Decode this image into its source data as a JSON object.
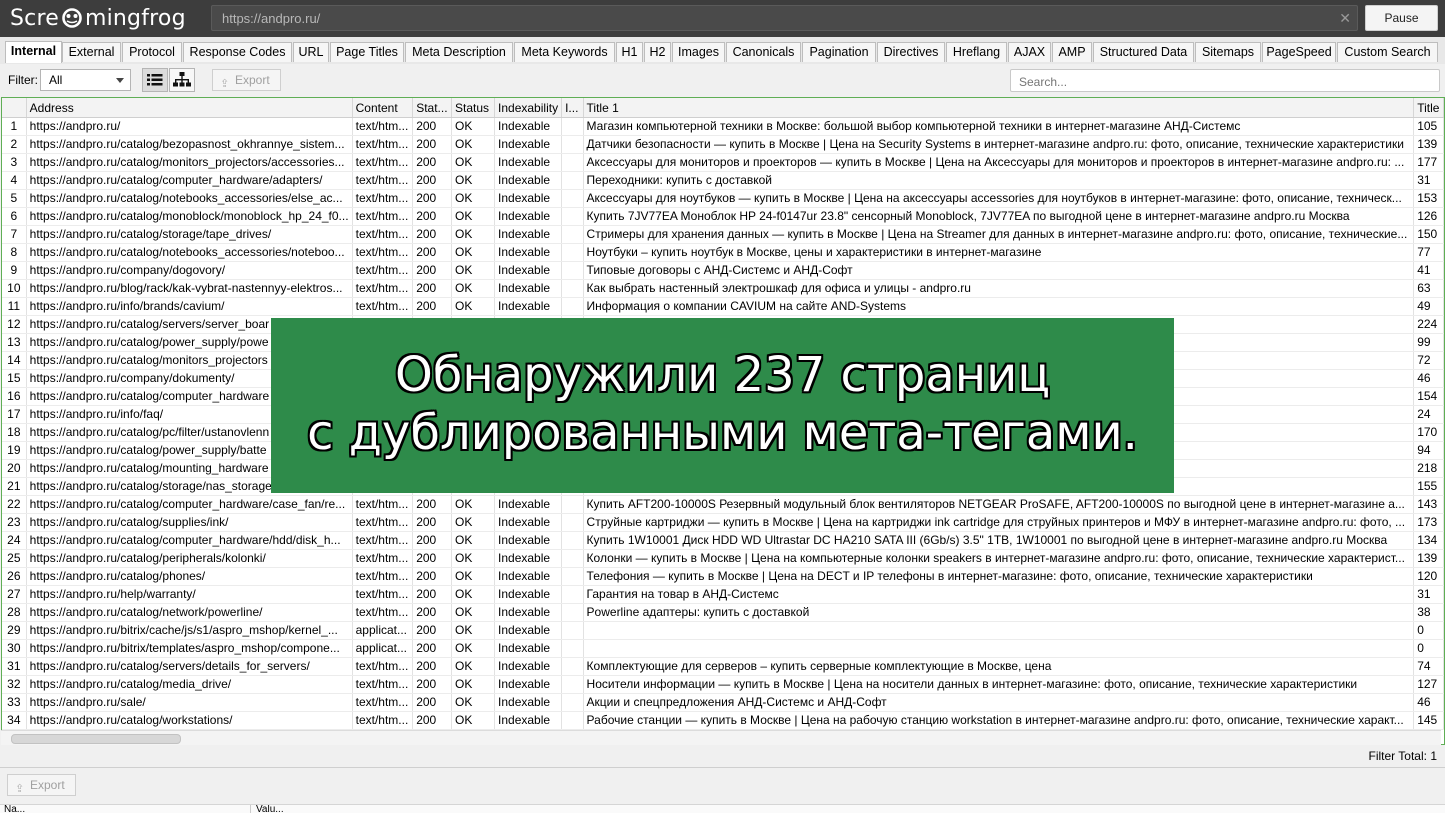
{
  "app": {
    "logo_pre": "Scre",
    "logo_post": "mingfrog"
  },
  "url_bar": {
    "value": "https://andpro.ru/",
    "clear": "✕"
  },
  "pause_label": "Pause",
  "tabs": [
    "Internal",
    "External",
    "Protocol",
    "Response Codes",
    "URL",
    "Page Titles",
    "Meta Description",
    "Meta Keywords",
    "H1",
    "H2",
    "Images",
    "Canonicals",
    "Pagination",
    "Directives",
    "Hreflang",
    "AJAX",
    "AMP",
    "Structured Data",
    "Sitemaps",
    "PageSpeed",
    "Custom Search"
  ],
  "filter": {
    "label": "Filter:",
    "value": "All"
  },
  "export_label": "Export",
  "search_placeholder": "Search...",
  "columns": [
    "",
    "Address",
    "Content",
    "Stat...",
    "Status",
    "Indexability",
    "I...",
    "Title 1",
    "Title"
  ],
  "rows": [
    [
      "1",
      "https://andpro.ru/",
      "text/htm...",
      "200",
      "OK",
      "Indexable",
      "",
      "Магазин компьютерной техники в Москве: большой выбор компьютерной техники в интернет-магазине АНД-Системс",
      "105"
    ],
    [
      "2",
      "https://andpro.ru/catalog/bezopasnost_okhrannye_sistem...",
      "text/htm...",
      "200",
      "OK",
      "Indexable",
      "",
      "Датчики безопасности — купить в Москве | Цена на Security Systems в интернет-магазине andpro.ru: фото, описание, технические характеристики",
      "139"
    ],
    [
      "3",
      "https://andpro.ru/catalog/monitors_projectors/accessories...",
      "text/htm...",
      "200",
      "OK",
      "Indexable",
      "",
      "Аксессуары для мониторов и проекторов — купить в Москве | Цена на Аксессуары для мониторов и проекторов в интернет-магазине andpro.ru: ...",
      "177"
    ],
    [
      "4",
      "https://andpro.ru/catalog/computer_hardware/adapters/",
      "text/htm...",
      "200",
      "OK",
      "Indexable",
      "",
      "Переходники: купить с доставкой",
      "31"
    ],
    [
      "5",
      "https://andpro.ru/catalog/notebooks_accessories/else_ac...",
      "text/htm...",
      "200",
      "OK",
      "Indexable",
      "",
      "Аксессуары для ноутбуков — купить в Москве | Цена на аксессуары accessories для ноутбуков в интернет-магазине: фото, описание, техническ...",
      "153"
    ],
    [
      "6",
      "https://andpro.ru/catalog/monoblock/monoblock_hp_24_f0...",
      "text/htm...",
      "200",
      "OK",
      "Indexable",
      "",
      "Купить 7JV77EA Моноблок HP 24-f0147ur 23.8\" сенсорный Monoblock, 7JV77EA по выгодной цене в интернет-магазине andpro.ru Москва",
      "126"
    ],
    [
      "7",
      "https://andpro.ru/catalog/storage/tape_drives/",
      "text/htm...",
      "200",
      "OK",
      "Indexable",
      "",
      "Стримеры для хранения данных — купить в Москве | Цена на Streamer для данных в интернет-магазине andpro.ru: фото, описание, технические...",
      "150"
    ],
    [
      "8",
      "https://andpro.ru/catalog/notebooks_accessories/noteboo...",
      "text/htm...",
      "200",
      "OK",
      "Indexable",
      "",
      "Ноутбуки – купить ноутбук в Москве, цены и характеристики в интернет-магазине",
      "77"
    ],
    [
      "9",
      "https://andpro.ru/company/dogovory/",
      "text/htm...",
      "200",
      "OK",
      "Indexable",
      "",
      "Типовые договоры с АНД-Системс и АНД-Софт",
      "41"
    ],
    [
      "10",
      "https://andpro.ru/blog/rack/kak-vybrat-nastennyy-elektros...",
      "text/htm...",
      "200",
      "OK",
      "Indexable",
      "",
      "Как выбрать настенный электрошкаф для офиса и улицы - andpro.ru",
      "63"
    ],
    [
      "11",
      "https://andpro.ru/info/brands/cavium/",
      "text/htm...",
      "200",
      "OK",
      "Indexable",
      "",
      "Информация о компании CAVIUM на сайте AND-Systems",
      "49"
    ],
    [
      "12",
      "https://andpro.ru/catalog/servers/server_boar",
      "",
      "",
      "",
      "",
      "",
      "агазине andpro.ru: подбор, сборка, тести...",
      "224"
    ],
    [
      "13",
      "https://andpro.ru/catalog/power_supply/powe",
      "",
      "",
      "",
      "",
      "",
      "ютера",
      "99"
    ],
    [
      "14",
      "https://andpro.ru/catalog/monitors_projectors",
      "",
      "",
      "",
      "",
      "",
      "",
      "72"
    ],
    [
      "15",
      "https://andpro.ru/company/dokumenty/",
      "",
      "",
      "",
      "",
      "",
      "",
      "46"
    ],
    [
      "16",
      "https://andpro.ru/catalog/computer_hardware",
      "",
      "",
      "",
      "",
      "",
      "зине andpro.ru: фото, описание, техниче...",
      "154"
    ],
    [
      "17",
      "https://andpro.ru/info/faq/",
      "",
      "",
      "",
      "",
      "",
      "",
      "24"
    ],
    [
      "18",
      "https://andpro.ru/catalog/pc/filter/ustanovlenn",
      "",
      "",
      "",
      "",
      "",
      "вс 10 Pro 64 в интернет-магазине: фото, ...",
      "170"
    ],
    [
      "19",
      "https://andpro.ru/catalog/power_supply/batte",
      "",
      "",
      "",
      "",
      "",
      "а",
      "94"
    ],
    [
      "20",
      "https://andpro.ru/catalog/mounting_hardware",
      "",
      "",
      "",
      "",
      "",
      "яторы охлаждения сетевого оборудован...",
      "218"
    ],
    [
      "21",
      "https://andpro.ru/catalog/storage/nas_storage",
      "",
      "",
      "",
      "",
      "",
      "агазине andpro.ru: фото, описание, техн...",
      "155"
    ],
    [
      "22",
      "https://andpro.ru/catalog/computer_hardware/case_fan/re...",
      "text/htm...",
      "200",
      "OK",
      "Indexable",
      "",
      "Купить AFT200-10000S Резервный модульный блок вентиляторов NETGEAR ProSAFE, AFT200-10000S по выгодной цене в интернет-магазине a...",
      "143"
    ],
    [
      "23",
      "https://andpro.ru/catalog/supplies/ink/",
      "text/htm...",
      "200",
      "OK",
      "Indexable",
      "",
      "Струйные картриджи — купить в Москве | Цена на картриджи ink cartridge для струйных принтеров и МФУ в интернет-магазине andpro.ru: фото, ...",
      "173"
    ],
    [
      "24",
      "https://andpro.ru/catalog/computer_hardware/hdd/disk_h...",
      "text/htm...",
      "200",
      "OK",
      "Indexable",
      "",
      "Купить 1W10001 Диск HDD WD Ultrastar DC HA210 SATA III (6Gb/s) 3.5\" 1TB, 1W10001 по выгодной цене в интернет-магазине andpro.ru Москва",
      "134"
    ],
    [
      "25",
      "https://andpro.ru/catalog/peripherals/kolonki/",
      "text/htm...",
      "200",
      "OK",
      "Indexable",
      "",
      "Колонки — купить в Москве | Цена на компьютерные колонки speakers в интернет-магазине andpro.ru: фото, описание, технические характерист...",
      "139"
    ],
    [
      "26",
      "https://andpro.ru/catalog/phones/",
      "text/htm...",
      "200",
      "OK",
      "Indexable",
      "",
      "Телефония — купить в Москве | Цена на DECT и IP телефоны в интернет-магазине: фото, описание, технические характеристики",
      "120"
    ],
    [
      "27",
      "https://andpro.ru/help/warranty/",
      "text/htm...",
      "200",
      "OK",
      "Indexable",
      "",
      "Гарантия на товар в АНД-Системс",
      "31"
    ],
    [
      "28",
      "https://andpro.ru/catalog/network/powerline/",
      "text/htm...",
      "200",
      "OK",
      "Indexable",
      "",
      "Powerline адаптеры: купить с доставкой",
      "38"
    ],
    [
      "29",
      "https://andpro.ru/bitrix/cache/js/s1/aspro_mshop/kernel_...",
      "applicat...",
      "200",
      "OK",
      "Indexable",
      "",
      "",
      "0"
    ],
    [
      "30",
      "https://andpro.ru/bitrix/templates/aspro_mshop/compone...",
      "applicat...",
      "200",
      "OK",
      "Indexable",
      "",
      "",
      "0"
    ],
    [
      "31",
      "https://andpro.ru/catalog/servers/details_for_servers/",
      "text/htm...",
      "200",
      "OK",
      "Indexable",
      "",
      "Комплектующие для серверов – купить серверные комплектующие в Москве, цена",
      "74"
    ],
    [
      "32",
      "https://andpro.ru/catalog/media_drive/",
      "text/htm...",
      "200",
      "OK",
      "Indexable",
      "",
      "Носители информации — купить в Москве | Цена на носители данных в интернет-магазине: фото, описание, технические характеристики",
      "127"
    ],
    [
      "33",
      "https://andpro.ru/sale/",
      "text/htm...",
      "200",
      "OK",
      "Indexable",
      "",
      "Акции и спецпредложения АНД-Системс и АНД-Софт",
      "46"
    ],
    [
      "34",
      "https://andpro.ru/catalog/workstations/",
      "text/htm...",
      "200",
      "OK",
      "Indexable",
      "",
      "Рабочие станции — купить в Москве | Цена на рабочую станцию workstation в интернет-магазине andpro.ru: фото, описание, технические характ...",
      "145"
    ]
  ],
  "filter_total": "Filter Total:  1",
  "bottom_columns": [
    "Na...",
    "Valu..."
  ],
  "overlay": {
    "line1": "Обнаружили 237 страниц",
    "line2": "с дублированными мета-тегами."
  },
  "colors": {
    "accent_green": "#2e8b4a",
    "topbar": "#3d3d3d"
  }
}
